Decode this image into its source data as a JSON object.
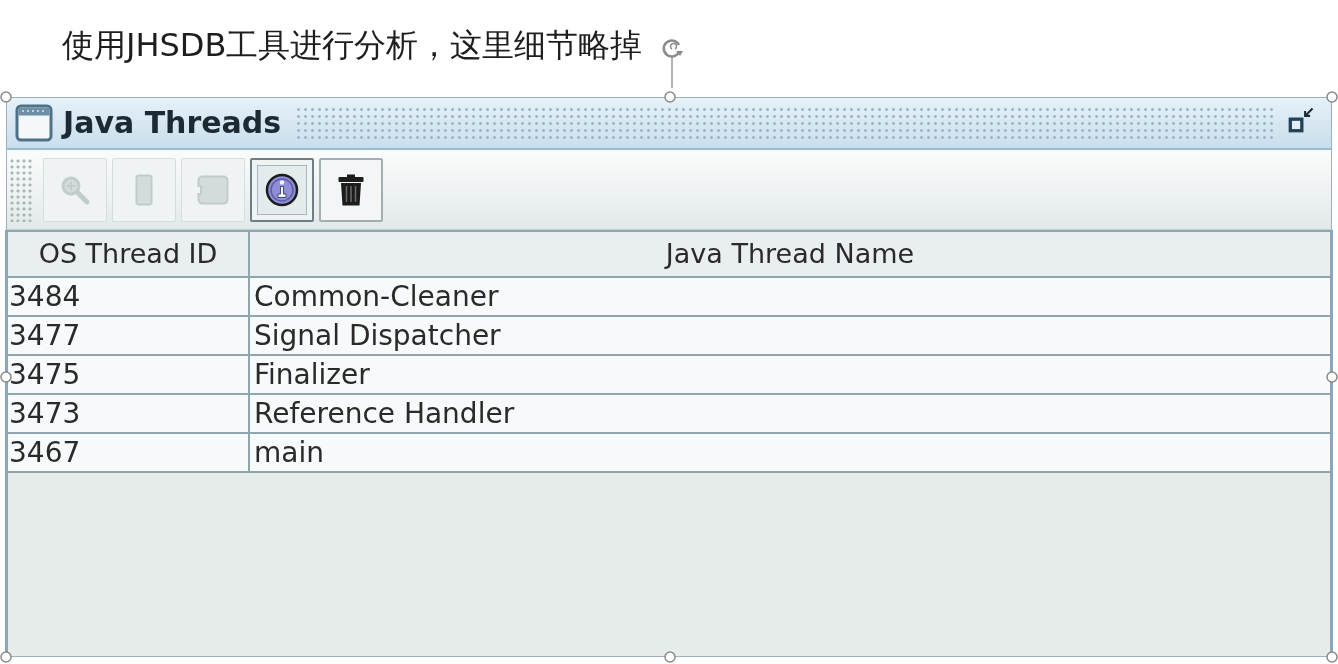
{
  "caption": "使用JHSDB工具进行分析，这里细节略掉",
  "window": {
    "title": "Java Threads"
  },
  "toolbar": [
    {
      "kind": "zoom",
      "disabled": true,
      "selected": false
    },
    {
      "kind": "panel",
      "disabled": true,
      "selected": false
    },
    {
      "kind": "block",
      "disabled": true,
      "selected": false
    },
    {
      "kind": "info",
      "disabled": false,
      "selected": true
    },
    {
      "kind": "trash",
      "disabled": false,
      "selected": false
    }
  ],
  "table": {
    "columns": [
      "OS Thread ID",
      "Java Thread Name"
    ],
    "rows": [
      [
        "3484",
        "Common-Cleaner"
      ],
      [
        "3477",
        "Signal Dispatcher"
      ],
      [
        "3475",
        "Finalizer"
      ],
      [
        "3473",
        "Reference Handler"
      ],
      [
        "3467",
        "main"
      ]
    ]
  }
}
